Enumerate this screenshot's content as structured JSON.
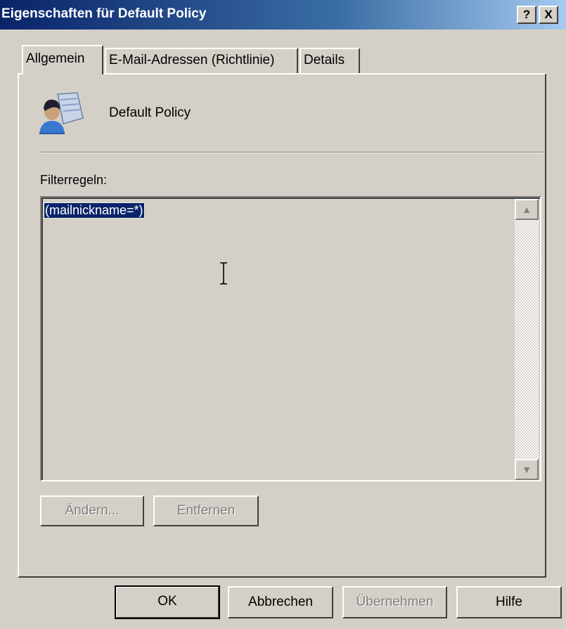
{
  "window": {
    "title": "Eigenschaften für Default Policy",
    "help_button": "?",
    "close_button": "X"
  },
  "tabs": [
    {
      "label": "Allgemein",
      "active": true
    },
    {
      "label": "E-Mail-Adressen (Richtlinie)",
      "active": false
    },
    {
      "label": "Details",
      "active": false
    }
  ],
  "general": {
    "policy_icon": "policy-user-icon",
    "policy_name": "Default Policy",
    "filter_label": "Filterregeln:",
    "filter_value": "(mailnickname=*)",
    "change_button": "Ändern...",
    "remove_button": "Entfernen"
  },
  "footer": {
    "ok": "OK",
    "cancel": "Abbrechen",
    "apply": "Übernehmen",
    "help": "Hilfe"
  },
  "colors": {
    "title_bar_start": "#0a246a",
    "title_bar_end": "#a6caf0",
    "face": "#d4d0c8",
    "selection": "#0a246a",
    "disabled_text": "#808080"
  }
}
